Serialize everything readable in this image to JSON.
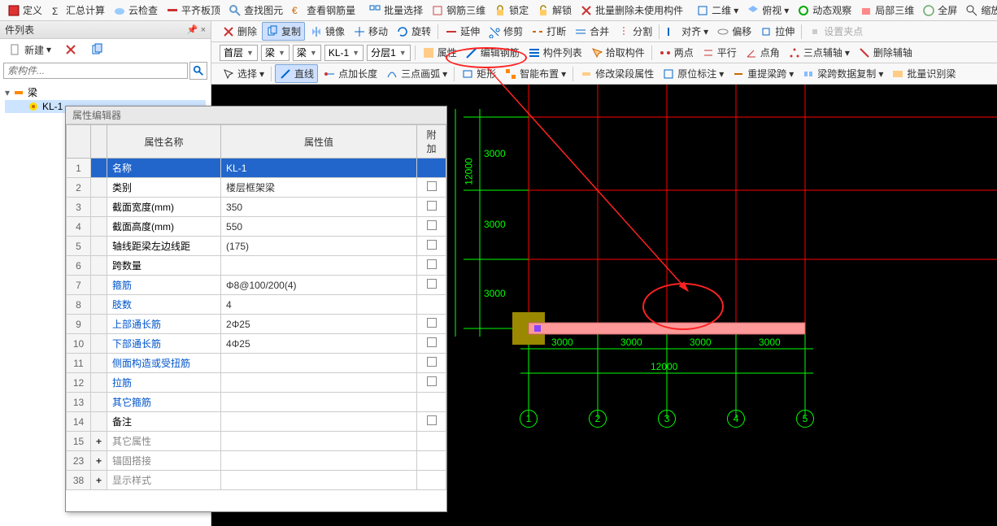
{
  "toolbar1": {
    "defn": "定义",
    "sum": "汇总计算",
    "cloud": "云检查",
    "flat": "平齐板顶",
    "find": "查找图元",
    "rebar": "查看钢筋量",
    "batchsel": "批量选择",
    "rebar3d": "钢筋三维",
    "lock": "锁定",
    "unlock": "解锁",
    "batchdel": "批量删除未使用构件",
    "v2d": "二维",
    "topview": "俯视",
    "dyn": "动态观察",
    "local3d": "局部三维",
    "full": "全屏",
    "zoom": "缩放"
  },
  "panel": {
    "title": "件列表",
    "pin": "⬜",
    "close": "×",
    "newbtn": "新建",
    "search_ph": "索构件...",
    "tree_root": "梁",
    "tree_item": "KL-1"
  },
  "toolbar2": {
    "del": "删除",
    "copy": "复制",
    "mirror": "镜像",
    "move": "移动",
    "rotate": "旋转",
    "extend": "延伸",
    "trim": "修剪",
    "break": "打断",
    "merge": "合并",
    "split": "分割",
    "align": "对齐",
    "offset": "偏移",
    "stretch": "拉伸",
    "setpick": "设置夹点"
  },
  "combos": {
    "floor": "首层",
    "type": "梁",
    "subtype": "梁",
    "elem": "KL-1",
    "layer": "分层1",
    "attr": "属性",
    "editrebar": "编辑钢筋",
    "list": "构件列表",
    "pick": "拾取构件",
    "twopoint": "两点",
    "parallel": "平行",
    "angle": "点角",
    "threeaux": "三点辅轴",
    "delaux": "删除辅轴"
  },
  "toolbar3": {
    "select": "选择",
    "line": "直线",
    "ptlen": "点加长度",
    "arc3": "三点画弧",
    "rect": "矩形",
    "smart": "智能布置",
    "modseg": "修改梁段属性",
    "origmark": "原位标注",
    "relayout": "重提梁跨",
    "copyspan": "梁跨数据复制",
    "batchid": "批量识别梁"
  },
  "prop": {
    "title": "属性编辑器",
    "h_name": "属性名称",
    "h_val": "属性值",
    "h_add": "附加",
    "rows": [
      {
        "i": "1",
        "n": "名称",
        "v": "KL-1",
        "sel": true
      },
      {
        "i": "2",
        "n": "类别",
        "v": "楼层框架梁",
        "chk": true
      },
      {
        "i": "3",
        "n": "截面宽度(mm)",
        "v": "350",
        "chk": true
      },
      {
        "i": "4",
        "n": "截面高度(mm)",
        "v": "550",
        "chk": true
      },
      {
        "i": "5",
        "n": "轴线距梁左边线距",
        "v": "(175)",
        "chk": true
      },
      {
        "i": "6",
        "n": "跨数量",
        "v": "",
        "chk": true
      },
      {
        "i": "7",
        "n": "箍筋",
        "v": "Φ8@100/200(4)",
        "link": true,
        "chk": true
      },
      {
        "i": "8",
        "n": "肢数",
        "v": "4",
        "link": true
      },
      {
        "i": "9",
        "n": "上部通长筋",
        "v": "2Φ25",
        "link": true,
        "chk": true
      },
      {
        "i": "10",
        "n": "下部通长筋",
        "v": "4Φ25",
        "link": true,
        "chk": true
      },
      {
        "i": "11",
        "n": "侧面构造或受扭筋",
        "v": "",
        "link": true,
        "chk": true
      },
      {
        "i": "12",
        "n": "拉筋",
        "v": "",
        "link": true,
        "chk": true
      },
      {
        "i": "13",
        "n": "其它箍筋",
        "v": "",
        "link": true
      },
      {
        "i": "14",
        "n": "备注",
        "v": "",
        "chk": true
      },
      {
        "i": "15",
        "n": "其它属性",
        "v": "",
        "gray": true,
        "plus": true
      },
      {
        "i": "23",
        "n": "锚固搭接",
        "v": "",
        "gray": true,
        "plus": true
      },
      {
        "i": "38",
        "n": "显示样式",
        "v": "",
        "gray": true,
        "plus": true
      }
    ]
  },
  "canvas": {
    "dims_v": [
      "3000",
      "3000",
      "3000"
    ],
    "dim_v_total": "12000",
    "dims_h": [
      "3000",
      "3000",
      "3000",
      "3000"
    ],
    "dim_h_total": "12000",
    "axes": [
      "1",
      "2",
      "3",
      "4",
      "5"
    ]
  }
}
